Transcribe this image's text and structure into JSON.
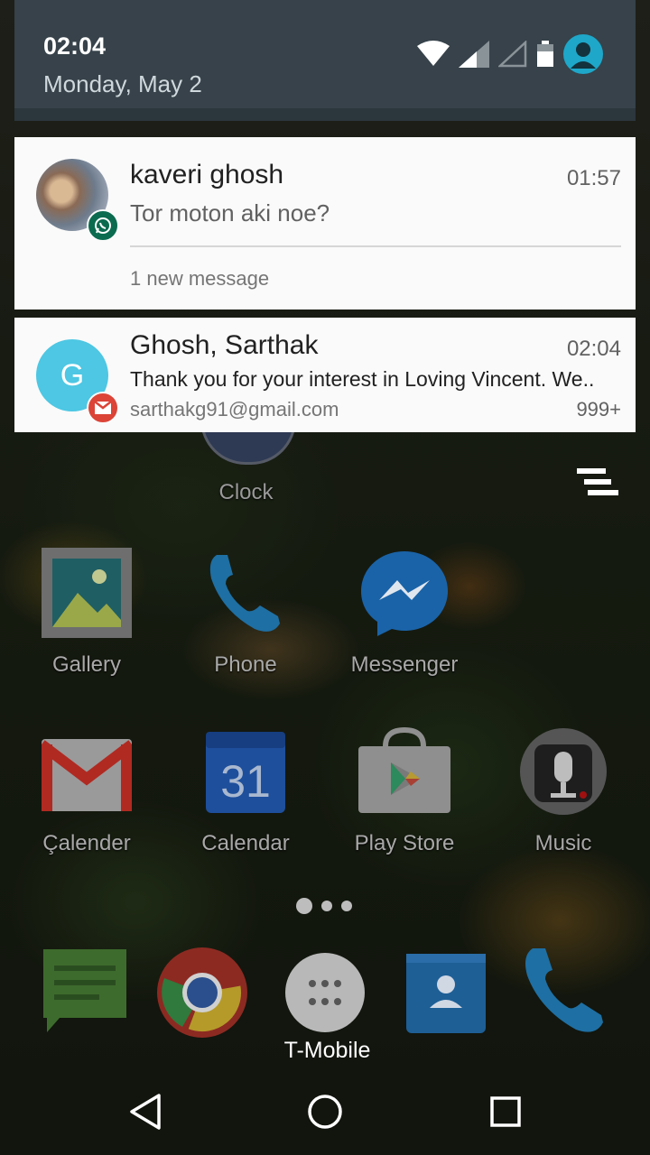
{
  "status_bar": {
    "time": "02:04",
    "date": "Monday, May 2",
    "icons": [
      "wifi-icon",
      "signal-icon",
      "signal-empty-icon",
      "battery-icon",
      "user-avatar-icon"
    ]
  },
  "notifications": [
    {
      "app": "WhatsApp",
      "sender": "kaveri ghosh",
      "time": "01:57",
      "message": "Tor moton aki noe?",
      "summary": "1 new message"
    },
    {
      "app": "Gmail",
      "avatar_letter": "G",
      "sender": "Ghosh, Sarthak",
      "time": "02:04",
      "subject": "Thank you for your interest in Loving Vincent. We..",
      "account": "sarthakg91@gmail.com",
      "count": "999+"
    }
  ],
  "home": {
    "partial_app_label": "Clock",
    "apps_row1": [
      "Gallery",
      "Phone",
      "Messenger"
    ],
    "apps_row2": [
      "Çalender",
      "Calendar",
      "Play Store",
      "Music"
    ],
    "calendar_day": "31",
    "dock_label": "T-Mobile"
  },
  "navbar": {
    "buttons": [
      "back",
      "home",
      "recents"
    ]
  },
  "colors": {
    "shade": "#37424a",
    "card": "#fafafa",
    "whatsapp_badge": "#0b6b4f",
    "gmail_badge": "#db4437",
    "gmail_avatar": "#4dc7e3",
    "account_avatar": "#1ea7c9"
  }
}
